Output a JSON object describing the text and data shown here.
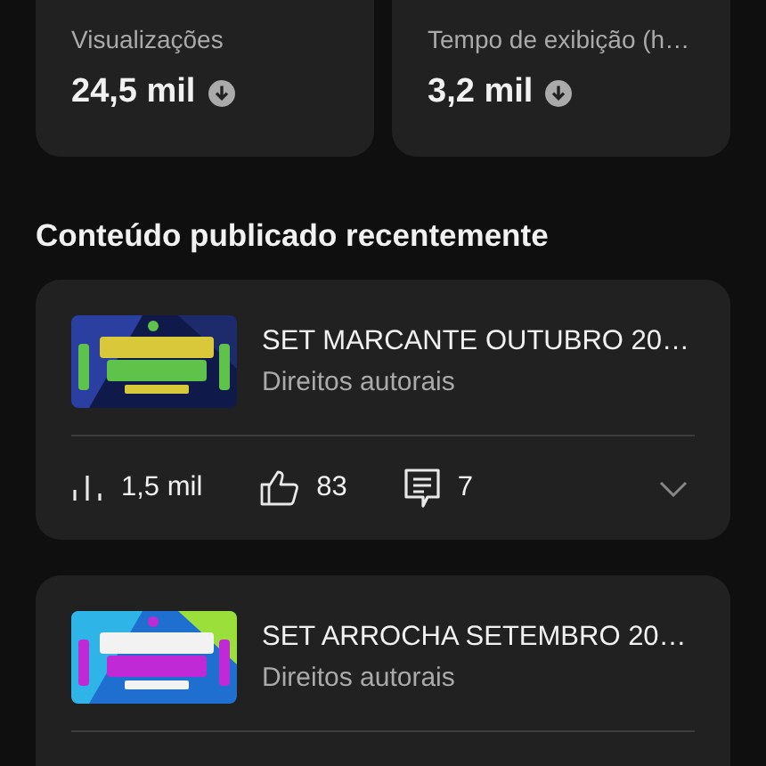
{
  "stats": [
    {
      "label": "Visualizações",
      "value": "24,5 mil"
    },
    {
      "label": "Tempo de exibição (h…",
      "value": "3,2 mil"
    }
  ],
  "section_title": "Conteúdo publicado recentemente",
  "videos": [
    {
      "title": "SET MARCANTE OUTUBRO 20…",
      "subtitle": "Direitos autorais",
      "views": "1,5 mil",
      "likes": "83",
      "comments": "7"
    },
    {
      "title": "SET ARROCHA SETEMBRO 20…",
      "subtitle": "Direitos autorais"
    }
  ]
}
